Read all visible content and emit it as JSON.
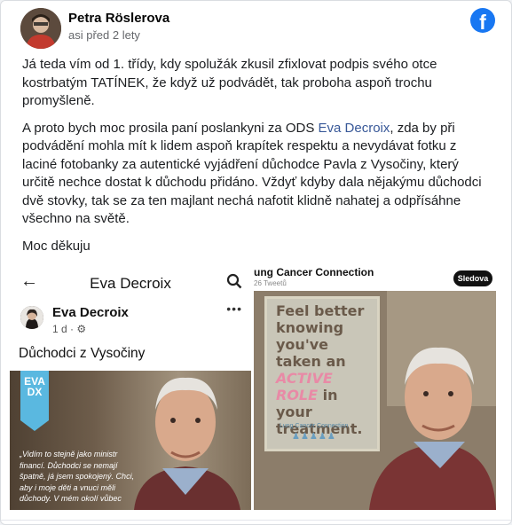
{
  "post": {
    "author": "Petra Röslerova",
    "time": "asi před 2 lety",
    "paragraphs": {
      "p1": "Já teda vím od 1. třídy, kdy spolužák zkusil zfixlovat podpis svého otce kostrbatým TATÍNEK, že když už podvádět, tak proboha aspoň trochu promyšleně.",
      "p2_before": "A proto bych moc prosila paní poslankyni za ODS ",
      "p2_link": "Eva Decroix",
      "p2_after": ", zda by při podvádění mohla mít k lidem aspoň krapítek respektu a nevydávat fotku z laciné fotobanky za autentické vyjádření důchodce Pavla z Vysočiny, který určitě nechce dostat k důchodu přidáno. Vždyť kdyby dala nějakýmu důchodci dvě stovky, tak se za ten majlant nechá nafotit klidně nahatej a odpřísáhne všechno na světě.",
      "p3": "Moc děkuju"
    }
  },
  "left_image": {
    "title": "Eva Decroix",
    "back_icon": "arrow-left-icon",
    "search_icon": "search-icon",
    "post_name": "Eva Decroix",
    "post_meta": "1 d · ⚙",
    "more_icon": "more-dots-icon",
    "caption": "Důchodci z Vysočiny",
    "badge": "EVA DX",
    "quote": "„Vidím to stejně jako ministr financí. Důchodci se nemají špatně, já jsem spokojený. Chci, aby i moje děti a vnuci měli důchody. V mém okolí vůbec"
  },
  "right_image": {
    "title": "ung Cancer Connection",
    "subtitle": "26 Tweetů",
    "follow": "Sledova",
    "quote_pre": "Feel better knowing you've taken an ",
    "quote_hl": "ACTIVE ROLE",
    "quote_post": " in your treatment.",
    "brand": "Lung Cancer Connection"
  },
  "colors": {
    "facebook_blue": "#1877f2",
    "link": "#385898"
  }
}
